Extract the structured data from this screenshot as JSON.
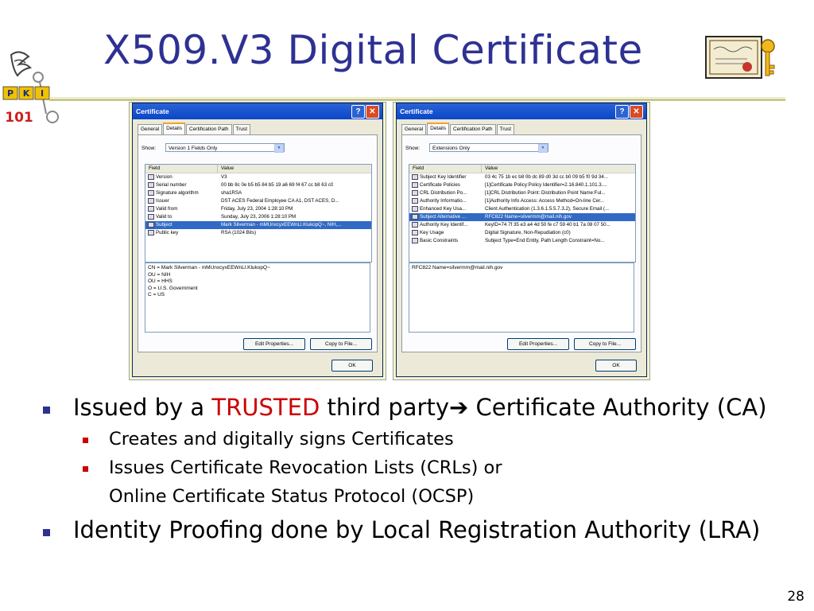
{
  "slide": {
    "title": "X509.V3 Digital Certificate",
    "page_number": "28",
    "logo_letters": [
      "P",
      "K",
      "I"
    ],
    "logo_number": "101",
    "accent_color": "#2e3192"
  },
  "dialogs": [
    {
      "title": "Certificate",
      "tabs": [
        "General",
        "Details",
        "Certification Path",
        "Trust"
      ],
      "active_tab": "Details",
      "show_label": "Show:",
      "show_value": "Version 1 Fields Only",
      "columns": [
        "Field",
        "Value"
      ],
      "rows": [
        {
          "field": "Version",
          "value": "V3",
          "selected": false
        },
        {
          "field": "Serial number",
          "value": "00 bb 8c 0e b5 b5 84 b5 19 a6 69 f4 67 cc b8 63 c0",
          "selected": false
        },
        {
          "field": "Signature algorithm",
          "value": "sha1RSA",
          "selected": false
        },
        {
          "field": "Issuer",
          "value": "DST ACES Federal Employee CA A1, DST ACES, D...",
          "selected": false
        },
        {
          "field": "Valid from",
          "value": "Friday, July 23, 2004 1:28:10 PM",
          "selected": false
        },
        {
          "field": "Valid to",
          "value": "Sunday, July 23, 2006 1:28:10 PM",
          "selected": false
        },
        {
          "field": "Subject",
          "value": "Mark Silverman - mMUnxcyxEEWnLl.KlukopQ~, NIH,...",
          "selected": true
        },
        {
          "field": "Public key",
          "value": "RSA (1024 Bits)",
          "selected": false
        }
      ],
      "detail_lines": [
        "CN = Mark Silverman - mMUnxcyxEEWnLl.KlukopQ~",
        "OU = NIH",
        "OU = HHS",
        "O = U.S. Government",
        "C = US"
      ],
      "edit_button": "Edit Properties...",
      "copy_button": "Copy to File...",
      "ok_button": "OK"
    },
    {
      "title": "Certificate",
      "tabs": [
        "General",
        "Details",
        "Certification Path",
        "Trust"
      ],
      "active_tab": "Details",
      "show_label": "Show:",
      "show_value": "Extensions Only",
      "columns": [
        "Field",
        "Value"
      ],
      "rows": [
        {
          "field": "Subject Key Identifier",
          "value": "03 4c 75 1b ec b8 0b dc 89 d0 3d cc b0 09 b5 f0 9d 34...",
          "selected": false
        },
        {
          "field": "Certificate Policies",
          "value": "[1]Certificate Policy:Policy Identifier=2.16.840.1.101.3....",
          "selected": false
        },
        {
          "field": "CRL Distribution Po...",
          "value": "[1]CRL Distribution Point: Distribution Point Name:Ful...",
          "selected": false
        },
        {
          "field": "Authority Informatio...",
          "value": "[1]Authority Info Access: Access Method=On-line Cer...",
          "selected": false
        },
        {
          "field": "Enhanced Key Usa...",
          "value": "Client Authentication (1.3.6.1.5.5.7.3.2), Secure Email (...",
          "selected": false
        },
        {
          "field": "Subject Alternative ...",
          "value": "RFC822 Name=silvermm@mail.nih.gov",
          "selected": true
        },
        {
          "field": "Authority Key Identif...",
          "value": "KeyID=74 7f 35 e3 a4 4d 50 fe c7 59 40 b1 7a 08 07 50...",
          "selected": false
        },
        {
          "field": "Key Usage",
          "value": "Digital Signature, Non-Repudiation (c0)",
          "selected": false
        },
        {
          "field": "Basic Constraints",
          "value": "Subject Type=End Entity, Path Length Constraint=No...",
          "selected": false
        }
      ],
      "detail_lines": [
        "RFC822 Name=silvermm@mail.nih.gov"
      ],
      "edit_button": "Edit Properties...",
      "copy_button": "Copy to File...",
      "ok_button": "OK"
    }
  ],
  "bullets": {
    "b1_pre": "Issued by a ",
    "b1_trusted": "TRUSTED",
    "b1_post": " third party",
    "b1_arrow": "➔",
    "b1_end": " Certificate Authority (CA)",
    "sub1": "Creates and digitally signs Certificates",
    "sub2": "Issues Certificate Revocation Lists (CRLs) or",
    "sub2_cont": "Online Certificate Status Protocol (OCSP)",
    "b2": "Identity Proofing done by Local Registration Authority (LRA)"
  }
}
